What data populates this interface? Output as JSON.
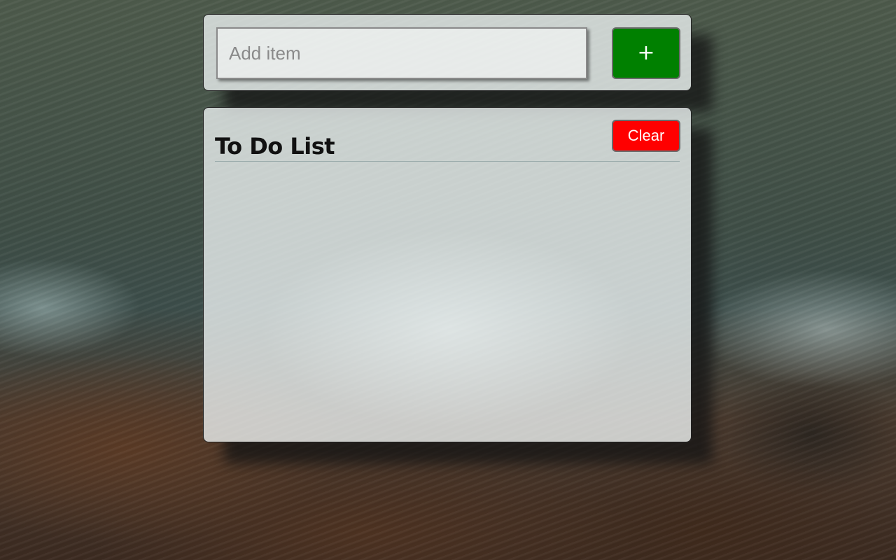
{
  "input_card": {
    "input_placeholder": "Add item",
    "input_value": "",
    "add_button_label": "+",
    "add_button_color": "#008000"
  },
  "list_card": {
    "title": "To Do List",
    "clear_button_label": "Clear",
    "clear_button_color": "#ff0000",
    "items": []
  }
}
